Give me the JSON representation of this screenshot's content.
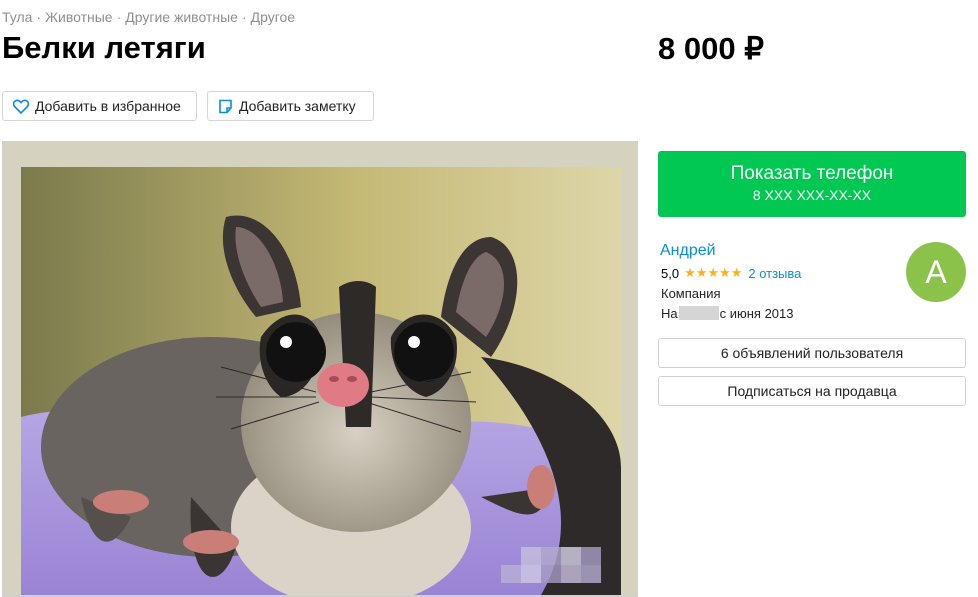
{
  "breadcrumb": [
    "Тула",
    "Животные",
    "Другие животные",
    "Другое"
  ],
  "title": "Белки летяги",
  "price": "8 000 ₽",
  "actions": {
    "favorite": "Добавить в избранное",
    "note": "Добавить заметку"
  },
  "contact": {
    "label": "Показать телефон",
    "number": "8 XXX XXX-XX-XX"
  },
  "seller": {
    "name": "Андрей",
    "rating": "5,0",
    "reviews": "2 отзыва",
    "type": "Компания",
    "since_prefix": "На",
    "since_suffix": "с июня 2013",
    "avatar_letter": "A"
  },
  "buttons": {
    "ads": "6 объявлений пользователя",
    "subscribe": "Подписаться на продавца"
  },
  "colors": {
    "accent_green": "#00c853",
    "link_blue": "#0a8ed8",
    "star": "#ffb021",
    "avatar": "#8bc34a"
  },
  "icons": {
    "favorite": "heart-icon",
    "note": "note-icon",
    "photo": "sugar-glider-photo"
  }
}
